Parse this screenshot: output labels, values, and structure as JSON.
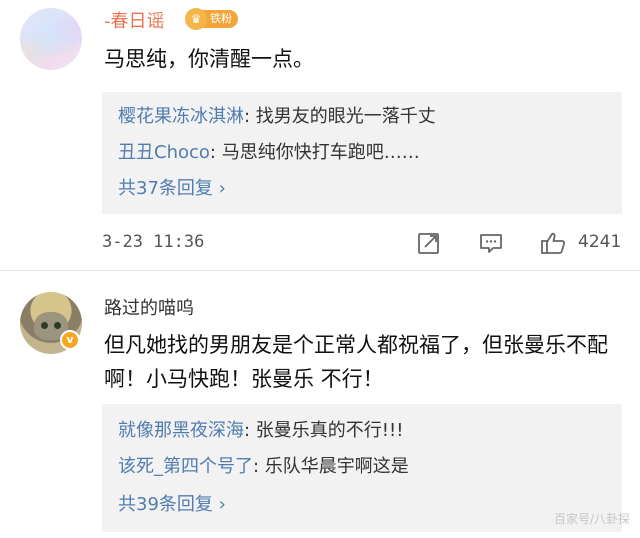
{
  "comments": [
    {
      "username": "-春日谣",
      "fan_badge": "铁粉",
      "text": "马思纯，你清醒一点。",
      "replies": [
        {
          "user": "樱花果冻冰淇淋",
          "text": ": 找男友的眼光一落千丈"
        },
        {
          "user": "丑丑Choco",
          "text": ": 马思纯你快打车跑吧……"
        }
      ],
      "more_replies": "共37条回复 ›",
      "timestamp": "3-23 11:36",
      "like_count": "4241"
    },
    {
      "username": "路过的喵呜",
      "verified_badge": "v",
      "text": "但凡她找的男朋友是个正常人都祝福了，但张曼乐不配啊！小马快跑！张曼乐 不行！",
      "replies": [
        {
          "user": "就像那黑夜深海",
          "text": ": 张曼乐真的不行!!!"
        },
        {
          "user": "该死_第四个号了",
          "text": ": 乐队华晨宇啊这是"
        }
      ],
      "more_replies": "共39条回复 ›"
    }
  ],
  "watermark": "百家号/八卦探",
  "icons": {
    "share": "share-icon",
    "comment": "comment-icon",
    "like": "thumbs-up-icon",
    "fan_crown": "crown-icon"
  },
  "colors": {
    "username_accent": "#eb7350",
    "reply_user": "#507daf",
    "reply_bg": "#f2f2f2",
    "fan_badge": "#f4a43a"
  }
}
